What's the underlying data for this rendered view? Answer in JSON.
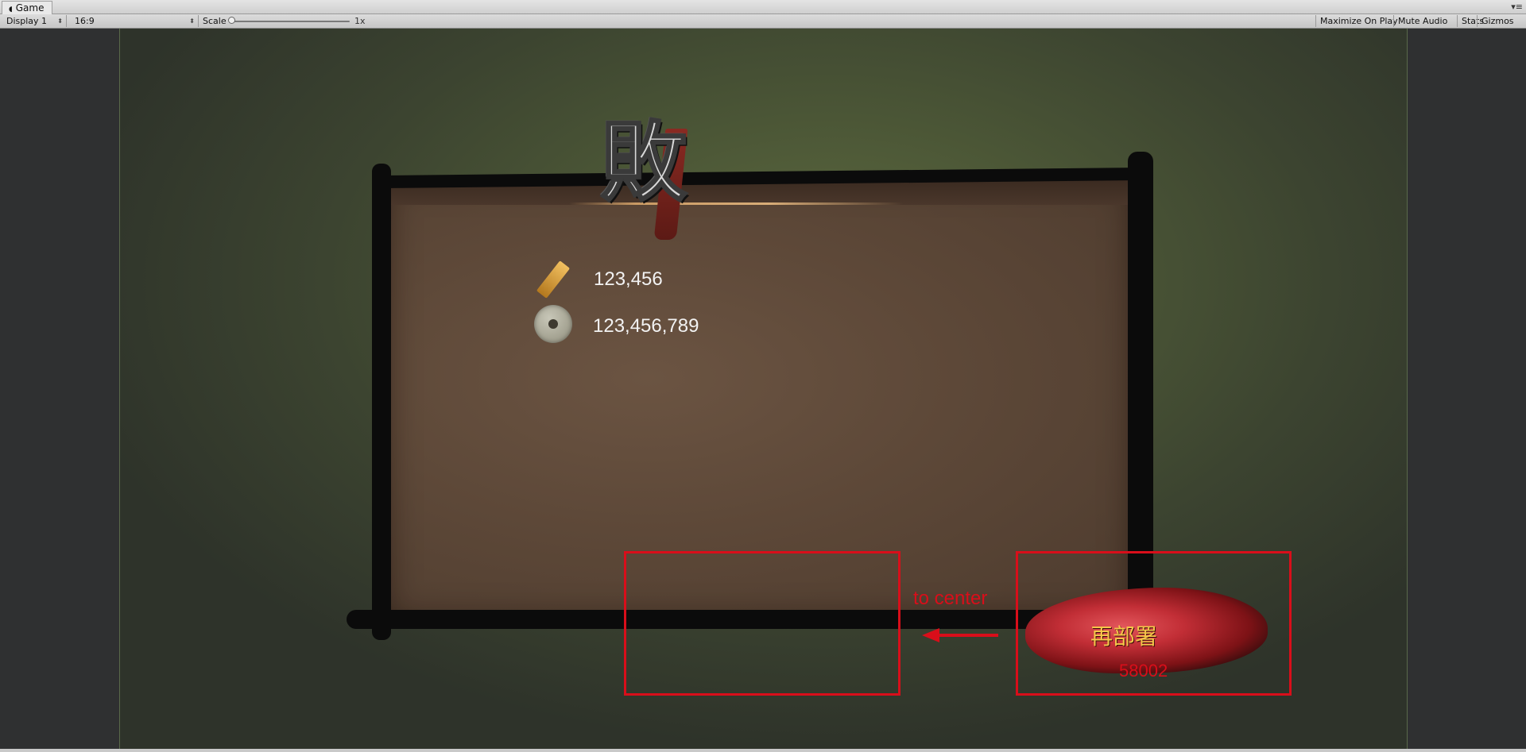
{
  "window": {
    "tab_icon": "unity-icon",
    "tab_icon_glyph": "◖",
    "tab_title": "Game",
    "menu_icon_glyph": "▾≡"
  },
  "toolbar": {
    "display": "Display 1",
    "aspect": "16:9",
    "scale_label": "Scale",
    "scale_value": "1x",
    "scale_fraction": 0.0,
    "arrow_glyph": "⬍",
    "buttons": {
      "maximize": "Maximize On Play",
      "mute": "Mute Audio",
      "stats": "Stats",
      "gizmos": "Gizmos"
    }
  },
  "game": {
    "defeat_title": "敗",
    "rewards": [
      {
        "icon": "tag-icon",
        "value": "123,456"
      },
      {
        "icon": "coin-icon",
        "value": "123,456,789"
      }
    ],
    "annotation": "to center",
    "redeploy": {
      "label": "再部署",
      "id": "58002"
    },
    "colors": {
      "annotation": "#d90e1a",
      "button_text": "#f5c64a"
    }
  }
}
